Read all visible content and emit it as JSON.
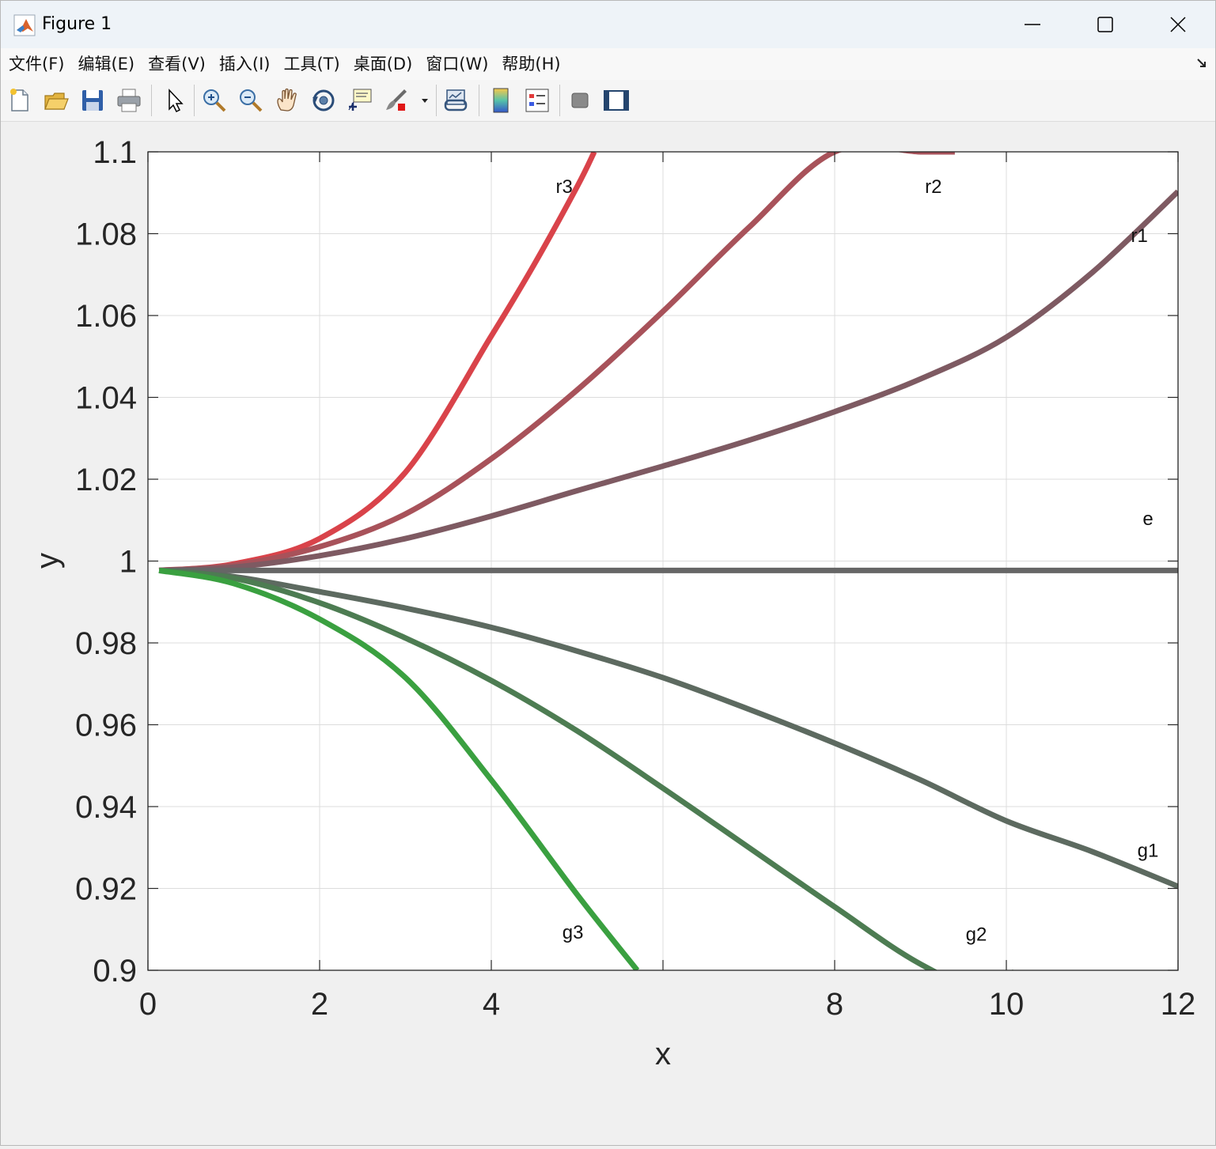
{
  "window": {
    "title": "Figure 1",
    "controls": [
      "minimize",
      "maximize",
      "close"
    ]
  },
  "menu": {
    "items": [
      {
        "label": "文件(F)",
        "name": "file"
      },
      {
        "label": "编辑(E)",
        "name": "edit"
      },
      {
        "label": "查看(V)",
        "name": "view"
      },
      {
        "label": "插入(I)",
        "name": "insert"
      },
      {
        "label": "工具(T)",
        "name": "tools"
      },
      {
        "label": "桌面(D)",
        "name": "desktop"
      },
      {
        "label": "窗口(W)",
        "name": "window"
      },
      {
        "label": "帮助(H)",
        "name": "help"
      }
    ]
  },
  "toolbar": {
    "icons": [
      "new-figure-icon",
      "open-file-icon",
      "save-icon",
      "print-icon",
      "select-arrow-icon",
      "zoom-in-icon",
      "zoom-out-icon",
      "pan-hand-icon",
      "rotate-3d-icon",
      "data-cursor-icon",
      "brush-icon",
      "brush-dropdown-icon",
      "link-plot-icon",
      "colorbar-icon",
      "legend-icon",
      "hide-plot-tools-icon",
      "show-plot-tools-icon"
    ]
  },
  "chart_data": {
    "type": "line",
    "xlabel": "x",
    "ylabel": "y",
    "xlim": [
      0,
      12
    ],
    "ylim": [
      0.9,
      1.1
    ],
    "xticks": [
      0,
      2,
      4,
      6,
      8,
      10,
      12
    ],
    "xtick_labels": [
      "0",
      "2",
      "4",
      "8",
      "10",
      "12"
    ],
    "yticks": [
      0.9,
      0.92,
      0.94,
      0.96,
      0.98,
      1.0,
      1.02,
      1.04,
      1.06,
      1.08,
      1.1
    ],
    "ytick_labels": [
      "0.9",
      "0.92",
      "0.94",
      "0.96",
      "0.98",
      "1",
      "1.02",
      "1.04",
      "1.06",
      "1.08",
      "1.1"
    ],
    "grid": true,
    "series": [
      {
        "name": "r3",
        "color": "#d9434a",
        "x": [
          0.13,
          1,
          2,
          3,
          4,
          4.5,
          5,
          5.2
        ],
        "y": [
          0.9977,
          0.9993,
          1.0055,
          1.0217,
          1.055,
          1.0725,
          1.0915,
          1.1
        ]
      },
      {
        "name": "r2",
        "color": "#a8525a",
        "x": [
          0.13,
          1,
          2,
          3,
          4,
          5,
          6,
          7,
          8,
          9,
          9.4
        ],
        "y": [
          0.9977,
          0.999,
          1.0035,
          1.0115,
          1.025,
          1.0418,
          1.061,
          1.0815,
          1.1,
          1.1,
          1.1
        ]
      },
      {
        "name": "r1",
        "color": "#7e5a62",
        "x": [
          0.13,
          1,
          2,
          3,
          4,
          5,
          6,
          7,
          8,
          9,
          10,
          11,
          12
        ],
        "y": [
          0.9977,
          0.9985,
          1.0013,
          1.0055,
          1.011,
          1.0172,
          1.0232,
          1.0295,
          1.0365,
          1.0445,
          1.0547,
          1.0705,
          1.0903
        ]
      },
      {
        "name": "e",
        "color": "#666666",
        "x": [
          0.13,
          12
        ],
        "y": [
          0.9977,
          0.9977
        ]
      },
      {
        "name": "g1",
        "color": "#5d6a60",
        "x": [
          0.13,
          1,
          2,
          3,
          4,
          5,
          6,
          7,
          8,
          9,
          10,
          11,
          12
        ],
        "y": [
          0.9977,
          0.9962,
          0.9925,
          0.9885,
          0.9838,
          0.978,
          0.9715,
          0.9638,
          0.9555,
          0.9465,
          0.9365,
          0.929,
          0.9205
        ]
      },
      {
        "name": "g2",
        "color": "#4d7c52",
        "x": [
          0.13,
          1,
          2,
          3,
          4,
          5,
          6,
          7,
          8,
          9,
          10,
          10.1
        ],
        "y": [
          0.9977,
          0.9958,
          0.9898,
          0.9812,
          0.9708,
          0.9585,
          0.9445,
          0.93,
          0.9155,
          0.9015,
          0.8925,
          0.9
        ]
      },
      {
        "name": "g3",
        "color": "#3aa040",
        "x": [
          0.13,
          1,
          2,
          3,
          4,
          5,
          5.7
        ],
        "y": [
          0.9977,
          0.9945,
          0.9858,
          0.9715,
          0.9465,
          0.9185,
          0.9
        ]
      }
    ],
    "annotations": [
      {
        "text": "r3",
        "x": 4.85,
        "y": 1.0915
      },
      {
        "text": "r2",
        "x": 9.15,
        "y": 1.0915
      },
      {
        "text": "r1",
        "x": 11.55,
        "y": 1.0795
      },
      {
        "text": "e",
        "x": 11.65,
        "y": 1.0103
      },
      {
        "text": "g1",
        "x": 11.65,
        "y": 0.9293
      },
      {
        "text": "g2",
        "x": 9.65,
        "y": 0.9088
      },
      {
        "text": "g3",
        "x": 4.95,
        "y": 0.9093
      }
    ]
  }
}
